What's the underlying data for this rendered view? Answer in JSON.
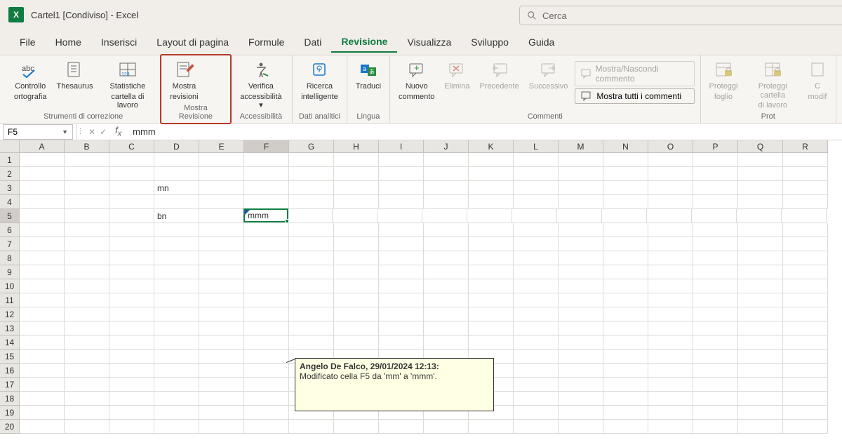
{
  "title": "Cartel1  [Condiviso]  -  Excel",
  "search_placeholder": "Cerca",
  "menu": {
    "file": "File",
    "home": "Home",
    "inserisci": "Inserisci",
    "layout": "Layout di pagina",
    "formule": "Formule",
    "dati": "Dati",
    "revisione": "Revisione",
    "visualizza": "Visualizza",
    "sviluppo": "Sviluppo",
    "guida": "Guida"
  },
  "ribbon": {
    "controllo": {
      "l1": "Controllo",
      "l2": "ortografia"
    },
    "thesaurus": "Thesaurus",
    "statistiche": {
      "l1": "Statistiche",
      "l2": "cartella di lavoro"
    },
    "group_strumenti": "Strumenti di correzione",
    "mostra_rev": {
      "l1": "Mostra",
      "l2": "revisioni"
    },
    "group_mostra": "Mostra Revisione",
    "verifica": {
      "l1": "Verifica",
      "l2": "accessibilità"
    },
    "group_access": "Accessibilità",
    "ricerca": {
      "l1": "Ricerca",
      "l2": "intelligente"
    },
    "group_dati": "Dati analitici",
    "traduci": "Traduci",
    "group_lingua": "Lingua",
    "nuovo": {
      "l1": "Nuovo",
      "l2": "commento"
    },
    "elimina": "Elimina",
    "precedente": "Precedente",
    "successivo": "Successivo",
    "mostra_nascondi": "Mostra/Nascondi commento",
    "mostra_tutti": "Mostra tutti i commenti",
    "group_commenti": "Commenti",
    "proteggi_foglio": {
      "l1": "Proteggi",
      "l2": "foglio"
    },
    "proteggi_cartella": {
      "l1": "Proteggi cartella",
      "l2": "di lavoro"
    },
    "cons": {
      "l1": "C",
      "l2": "modif"
    },
    "group_prot": "Prot"
  },
  "namebox": "F5",
  "formula": "mmm",
  "cells": {
    "D3": "mn",
    "D5": "bn",
    "F5": "mmm"
  },
  "cols": [
    "A",
    "B",
    "C",
    "D",
    "E",
    "F",
    "G",
    "H",
    "I",
    "J",
    "K",
    "L",
    "M",
    "N",
    "O",
    "P",
    "Q",
    "R"
  ],
  "rows": [
    "1",
    "2",
    "3",
    "4",
    "5",
    "6",
    "7",
    "8",
    "9",
    "10",
    "11",
    "12",
    "13",
    "14",
    "15",
    "16",
    "17",
    "18",
    "19",
    "20"
  ],
  "tooltip": {
    "header": "Angelo De Falco, 29/01/2024 12:13:",
    "body": "Modificato cella F5 da 'mm' a 'mmm'."
  }
}
